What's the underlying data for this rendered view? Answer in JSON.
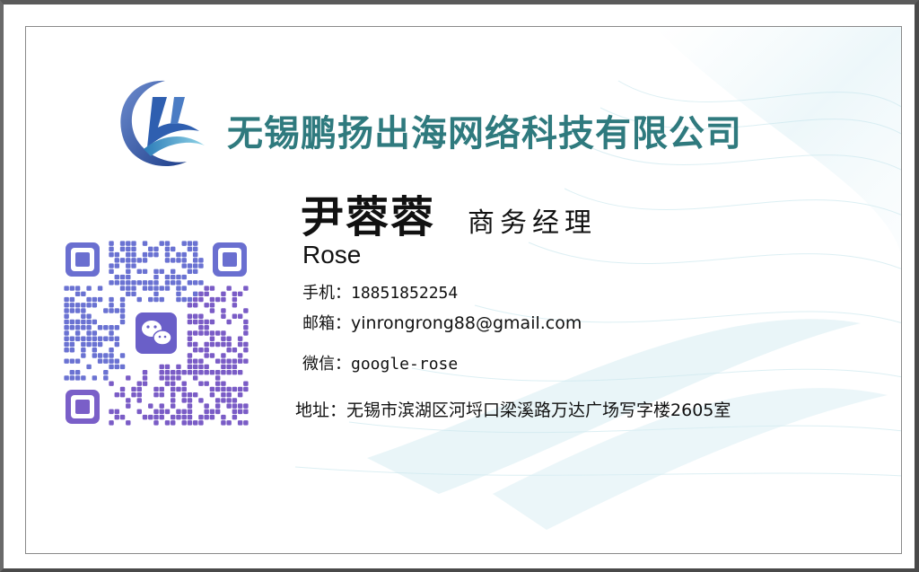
{
  "card": {
    "company": "无锡鹏扬出海网络科技有限公司",
    "name_cn": "尹蓉蓉",
    "title_cn": "商务经理",
    "name_en": "Rose",
    "phone_label": "手机：",
    "phone": "18851852254",
    "email_label": "邮箱：",
    "email": "yinrongrong88@gmail.com",
    "wechat_label": "微信：",
    "wechat": "google-rose",
    "address_label": "地址：",
    "address": "无锡市滨湖区河埒口梁溪路万达广场写字楼2605室"
  },
  "colors": {
    "company_text": "#2f7a7e",
    "logo_blue": "#3a5fa8",
    "logo_teal": "#3aa6c4",
    "qr_purple": "#6a5fc8",
    "qr_center": "#6a5fc8"
  },
  "icons": {
    "logo": "company-logo",
    "qr": "wechat-qr-code",
    "qr_center": "wechat-icon"
  }
}
